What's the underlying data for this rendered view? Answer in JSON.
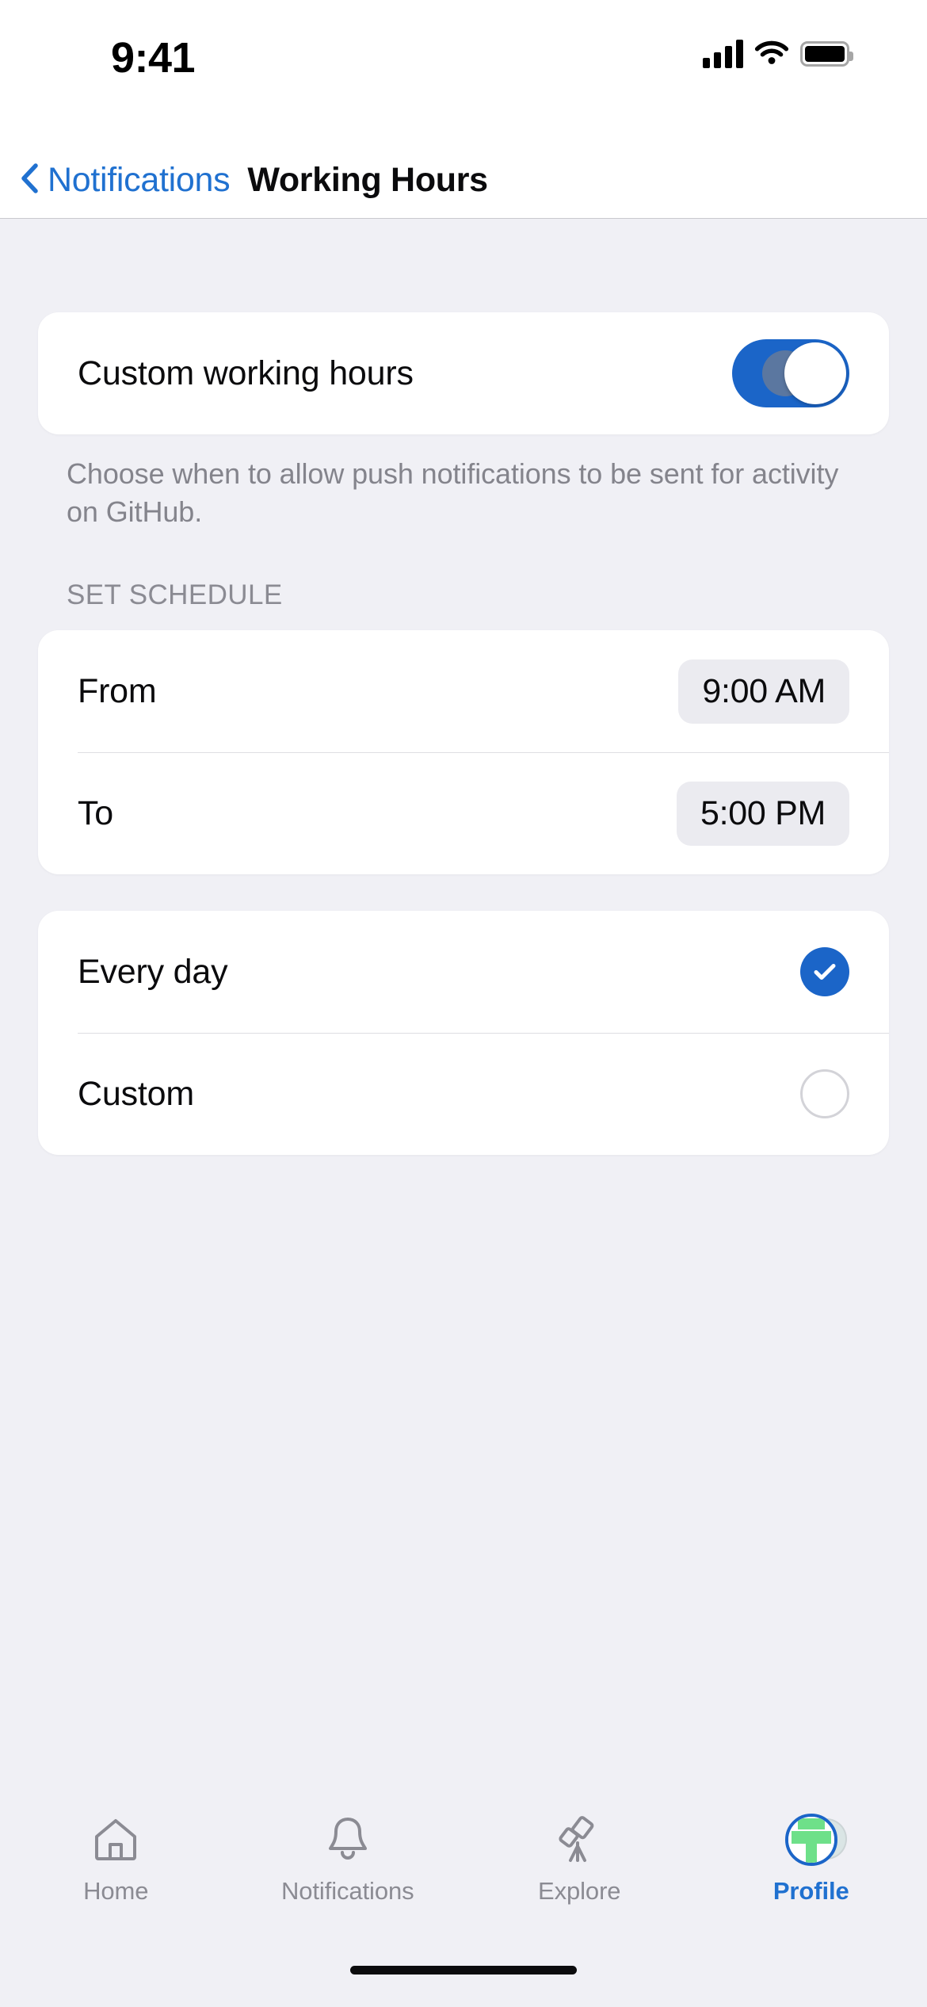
{
  "status_bar": {
    "time": "9:41",
    "cellular_icon": "cellular-bars-icon",
    "wifi_icon": "wifi-icon",
    "battery_icon": "battery-full-icon"
  },
  "nav": {
    "back_icon": "chevron-left-icon",
    "back_label": "Notifications",
    "title": "Working Hours"
  },
  "toggle_card": {
    "label": "Custom working hours",
    "toggle_state": "on",
    "toggle_on_color": "#1B65C8"
  },
  "description": "Choose when to allow push notifications to be sent for activity on GitHub.",
  "schedule": {
    "section_header": "SET SCHEDULE",
    "rows": [
      {
        "label": "From",
        "value": "9:00 AM"
      },
      {
        "label": "To",
        "value": "5:00 PM"
      }
    ]
  },
  "repeat": {
    "options": [
      {
        "label": "Every day",
        "selected": true,
        "icon": "check-circle-icon"
      },
      {
        "label": "Custom",
        "selected": false,
        "icon": "empty-circle-icon"
      }
    ],
    "selected_color": "#1B65C8"
  },
  "tab_bar": {
    "tabs": [
      {
        "label": "Home",
        "icon": "home-icon",
        "active": false
      },
      {
        "label": "Notifications",
        "icon": "bell-icon",
        "active": false
      },
      {
        "label": "Explore",
        "icon": "telescope-icon",
        "active": false
      },
      {
        "label": "Profile",
        "icon": "avatar-icon",
        "active": true
      }
    ],
    "active_color": "#2071D0",
    "inactive_color": "#8B8B93"
  }
}
